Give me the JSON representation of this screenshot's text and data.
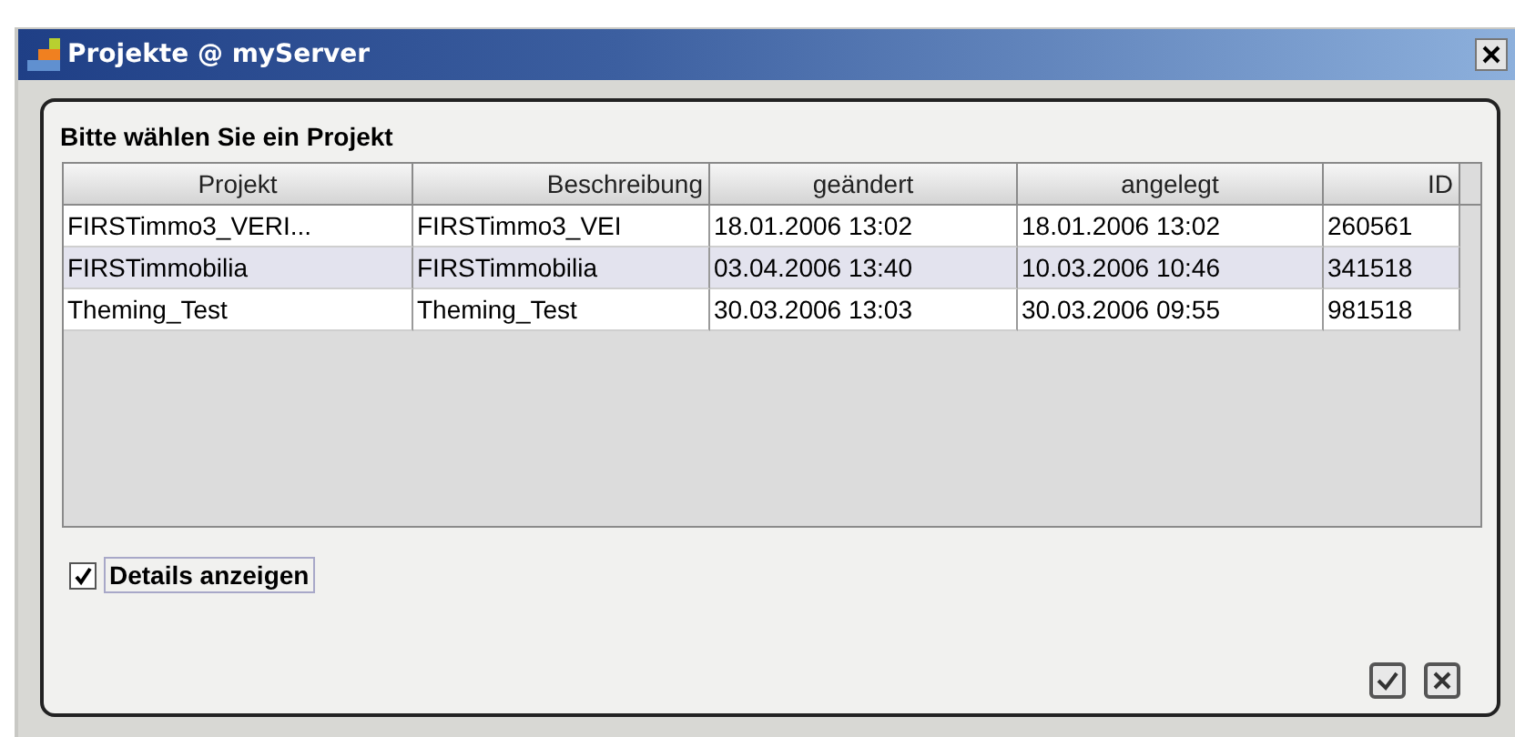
{
  "window": {
    "title": "Projekte @ myServer"
  },
  "prompt": "Bitte wählen Sie ein Projekt",
  "table": {
    "columns": [
      "Projekt",
      "Beschreibung",
      "geändert",
      "angelegt",
      "ID"
    ],
    "rows": [
      {
        "cells": [
          "FIRSTimmo3_VERI...",
          "FIRSTimmo3_VEI",
          "18.01.2006 13:02",
          "18.01.2006 13:02",
          "260561"
        ],
        "selected": false
      },
      {
        "cells": [
          "FIRSTimmobilia",
          "FIRSTimmobilia",
          "03.04.2006 13:40",
          "10.03.2006 10:46",
          "341518"
        ],
        "selected": true
      },
      {
        "cells": [
          "Theming_Test",
          "Theming_Test",
          "30.03.2006 13:03",
          "30.03.2006 09:55",
          "981518"
        ],
        "selected": false
      }
    ]
  },
  "details_checkbox": {
    "label": "Details anzeigen",
    "checked": true
  }
}
